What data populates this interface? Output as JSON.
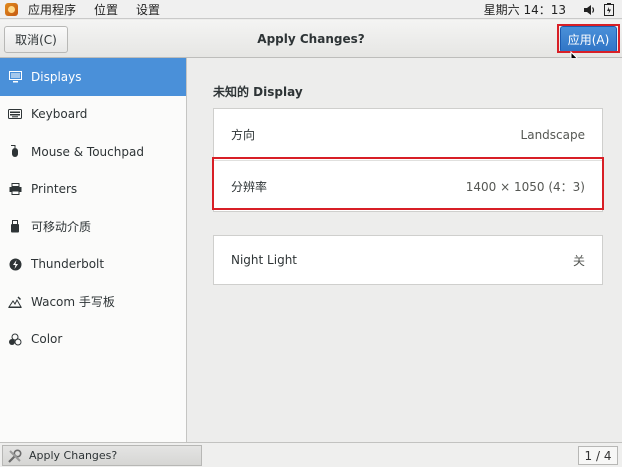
{
  "top_panel": {
    "menu": [
      "应用程序",
      "位置",
      "设置"
    ],
    "clock": "星期六 14：13",
    "icons": [
      "apps-icon",
      "volume-icon",
      "battery-icon"
    ]
  },
  "header": {
    "cancel_label": "取消(C)",
    "title": "Apply Changes?",
    "apply_label": "应用(A)",
    "accent_color": "#4a90d9",
    "highlight_color": "#d81f26"
  },
  "sidebar": {
    "items": [
      {
        "label": "Displays",
        "icon": "display-icon",
        "active": true
      },
      {
        "label": "Keyboard",
        "icon": "keyboard-icon"
      },
      {
        "label": "Mouse & Touchpad",
        "icon": "mouse-icon"
      },
      {
        "label": "Printers",
        "icon": "printer-icon"
      },
      {
        "label": "可移动介质",
        "icon": "removable-media-icon"
      },
      {
        "label": "Thunderbolt",
        "icon": "thunderbolt-icon"
      },
      {
        "label": "Wacom 手写板",
        "icon": "tablet-icon"
      },
      {
        "label": "Color",
        "icon": "color-icon"
      }
    ]
  },
  "main": {
    "section_title": "未知的  Display",
    "orientation": {
      "label": "方向",
      "value": "Landscape"
    },
    "resolution": {
      "label": "分辨率",
      "value": "1400 × 1050 (4：3)"
    },
    "night_light": {
      "label": "Night Light",
      "value": "关"
    }
  },
  "taskbar": {
    "task_label": "Apply Changes?",
    "pager": "1 / 4"
  }
}
